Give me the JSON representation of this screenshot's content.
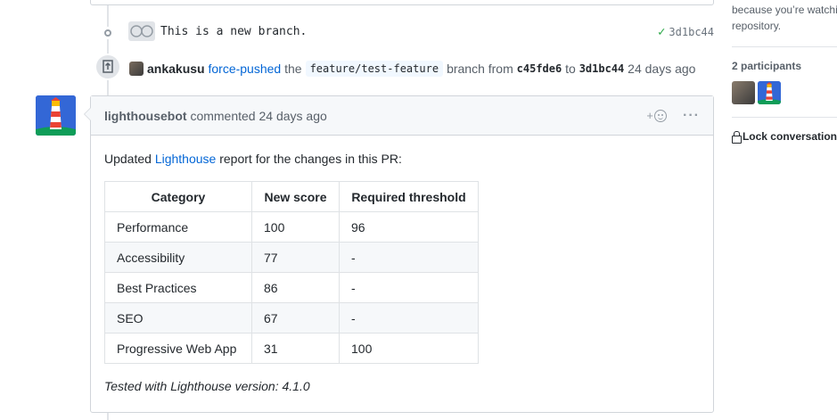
{
  "commit": {
    "message": "This is a new branch.",
    "sha": "3d1bc44",
    "status_icon": "check-icon"
  },
  "event": {
    "actor": "ankakusu",
    "action": "force-pushed",
    "word_the": "the",
    "branch": "feature/test-feature",
    "word_branch_from": "branch from",
    "from_sha": "c45fde6",
    "word_to": "to",
    "to_sha": "3d1bc44",
    "time": "24 days ago"
  },
  "comment": {
    "author": "lighthousebot",
    "action": "commented",
    "time": "24 days ago",
    "add_reaction": "+",
    "intro_before": "Updated ",
    "intro_link": "Lighthouse",
    "intro_after": " report for the changes in this PR:",
    "table": {
      "headers": [
        "Category",
        "New score",
        "Required threshold"
      ],
      "rows": [
        [
          "Performance",
          "100",
          "96"
        ],
        [
          "Accessibility",
          "77",
          "-"
        ],
        [
          "Best Practices",
          "86",
          "-"
        ],
        [
          "SEO",
          "67",
          "-"
        ],
        [
          "Progressive Web App",
          "31",
          "100"
        ]
      ]
    },
    "footer": "Tested with Lighthouse version: 4.1.0"
  },
  "sidebar": {
    "notify_line1": "because you’re watching",
    "notify_line2": "repository.",
    "participants_label": "2 participants",
    "lock_label": "Lock conversation"
  },
  "colors": {
    "link": "#0366d6",
    "success": "#28a745",
    "bot_blue": "#3367d6"
  }
}
